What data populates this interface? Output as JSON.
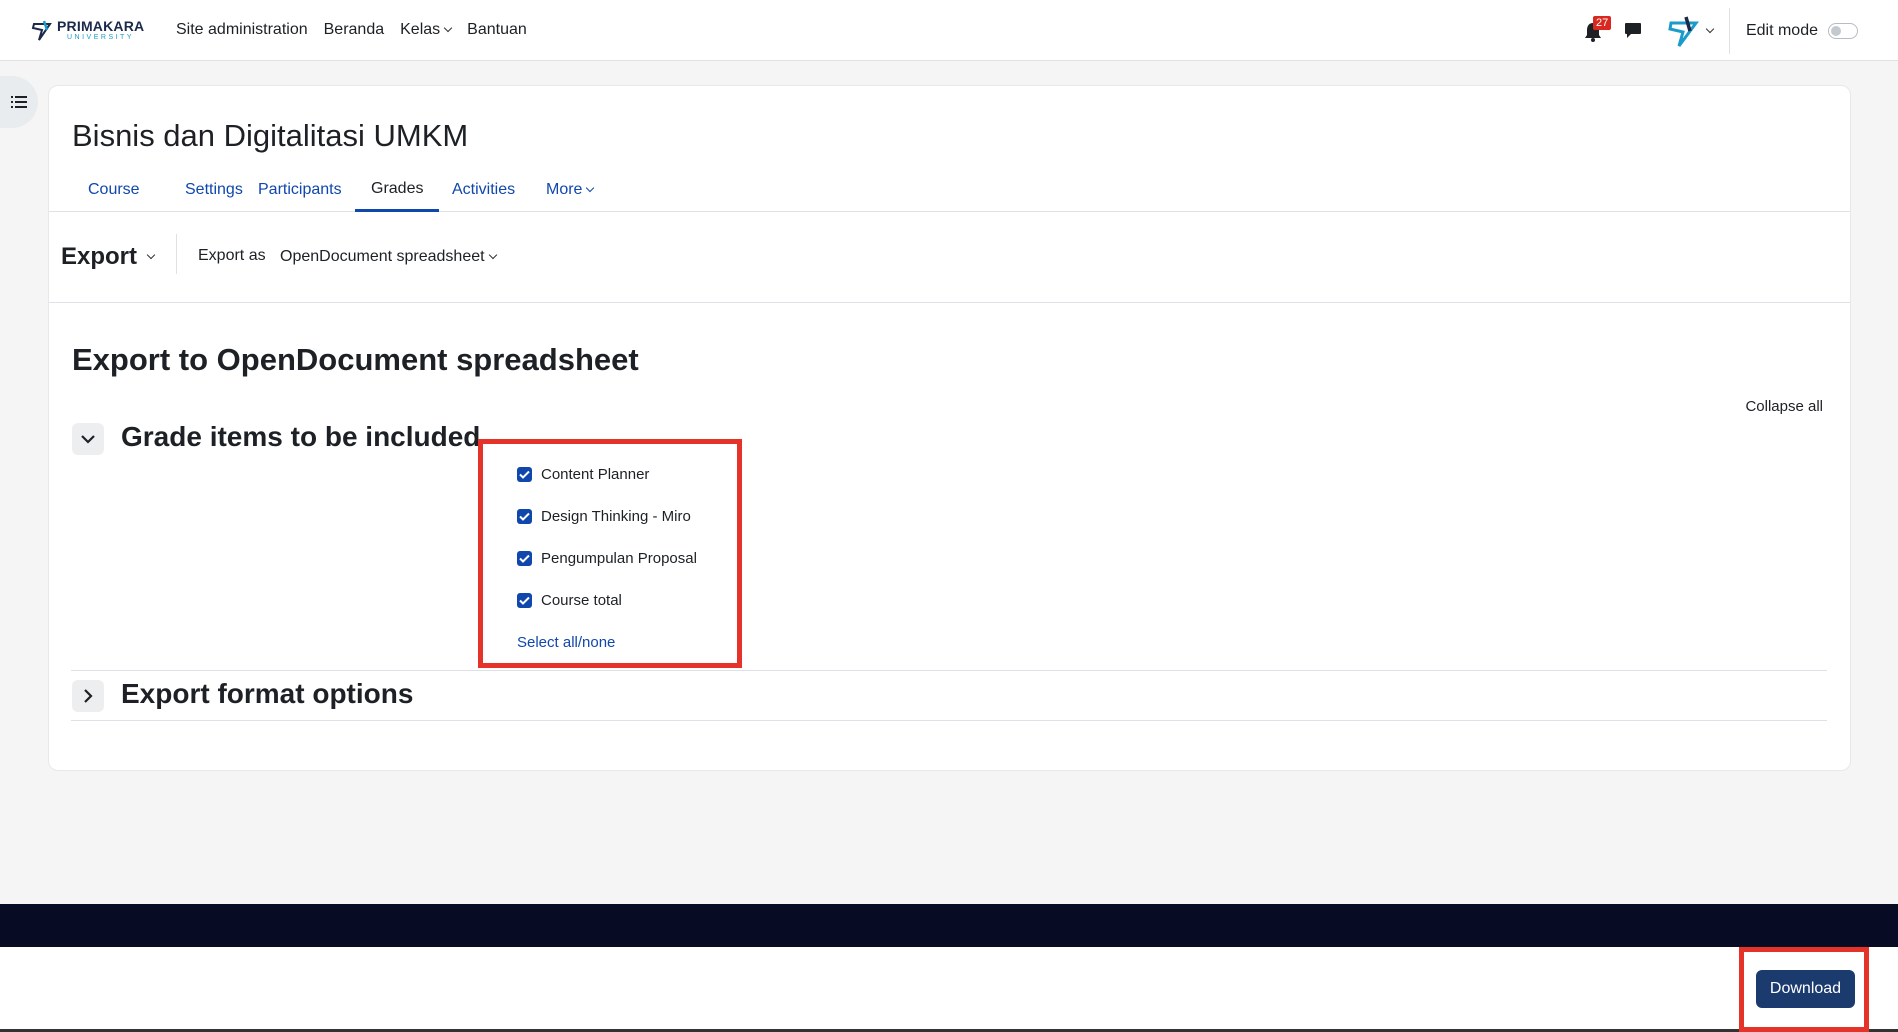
{
  "brand": {
    "name": "PRIMAKARA",
    "sub": "UNIVERSITY"
  },
  "nav": {
    "items": [
      "Site administration",
      "Beranda",
      "Kelas",
      "Bantuan"
    ],
    "notification_count": "27",
    "edit_mode_label": "Edit mode"
  },
  "course": {
    "title": "Bisnis dan Digitalitasi UMKM"
  },
  "tabs": [
    "Course",
    "Settings",
    "Participants",
    "Grades",
    "Activities",
    "More"
  ],
  "active_tab": "Grades",
  "export_bar": {
    "title": "Export",
    "export_as_label": "Export as",
    "format_value": "OpenDocument spreadsheet"
  },
  "page": {
    "title": "Export to OpenDocument spreadsheet",
    "collapse_all": "Collapse all"
  },
  "sections": {
    "grade_items": {
      "title": "Grade items to be included",
      "items": [
        {
          "label": "Content Planner",
          "checked": true
        },
        {
          "label": "Design Thinking - Miro",
          "checked": true
        },
        {
          "label": "Pengumpulan Proposal",
          "checked": true
        },
        {
          "label": "Course total",
          "checked": true
        }
      ],
      "select_all": "Select all/none"
    },
    "format_options": {
      "title": "Export format options"
    }
  },
  "footer": {
    "download_label": "Download"
  },
  "colors": {
    "primary": "#0f47ad",
    "highlight": "#e5332a",
    "download_bg": "#1b3a6e",
    "footer_dark": "#070b24"
  }
}
